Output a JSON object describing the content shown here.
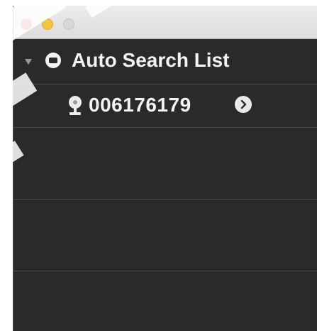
{
  "window": {
    "traffic_lights": [
      "close",
      "minimize",
      "maximize-disabled"
    ]
  },
  "tree": {
    "group": {
      "label": "Auto Search List",
      "expanded": true,
      "icon": "folder-circle-icon"
    },
    "items": [
      {
        "label": "006176179",
        "icon": "camera-icon",
        "action_icon": "chevron-right-circle-icon"
      }
    ]
  },
  "colors": {
    "background": "#2a2a2c",
    "divider": "#4b4b4d",
    "text": "#f3f3f3",
    "close": "#f2695f",
    "minimize": "#f6c242",
    "maximize": "#d7d7d7"
  }
}
